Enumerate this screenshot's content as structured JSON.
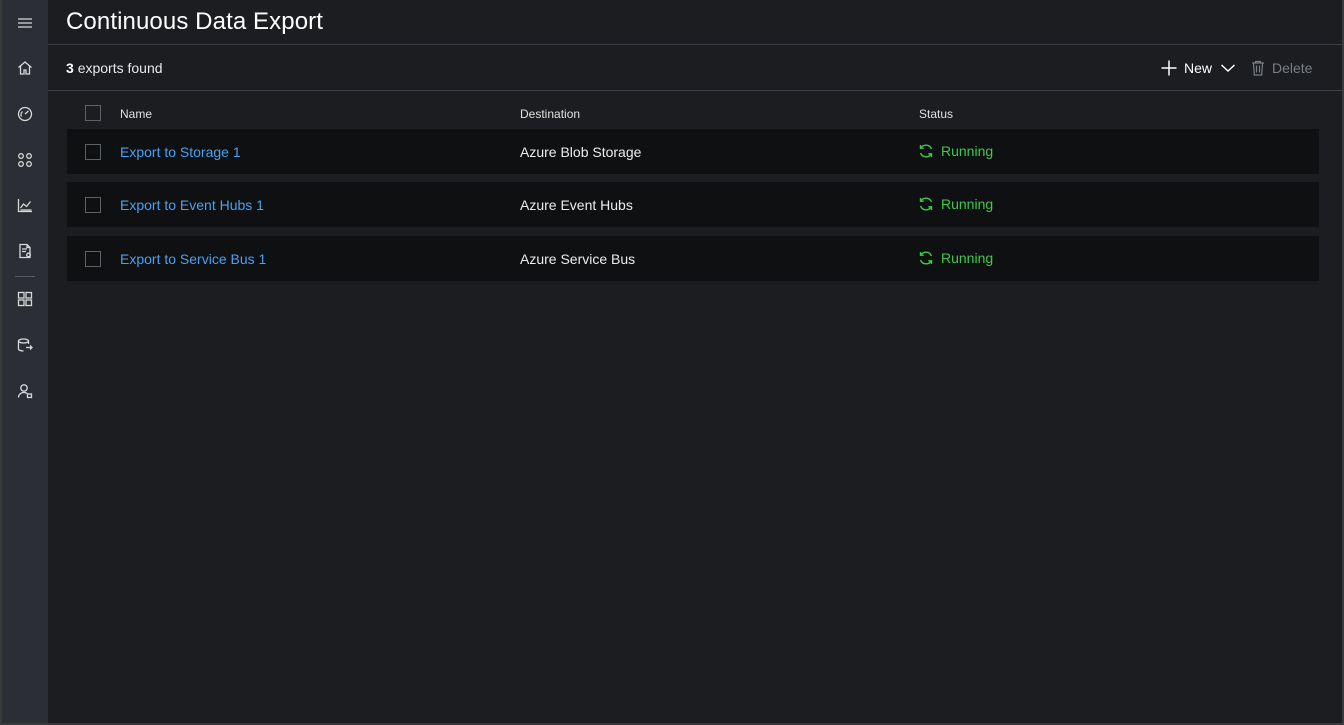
{
  "page": {
    "title": "Continuous Data Export"
  },
  "sidebar": {
    "items": [
      {
        "icon": "hamburger-menu-icon"
      },
      {
        "icon": "home-icon"
      },
      {
        "icon": "dashboard-gauge-icon"
      },
      {
        "icon": "devices-icon"
      },
      {
        "icon": "analytics-chart-icon"
      },
      {
        "icon": "jobs-document-icon"
      },
      {
        "icon": "app-templates-grid-icon"
      },
      {
        "icon": "data-export-icon"
      },
      {
        "icon": "administration-user-icon"
      }
    ]
  },
  "toolbar": {
    "count": "3",
    "count_suffix": "exports found",
    "new_label": "New",
    "delete_label": "Delete"
  },
  "table": {
    "columns": [
      "Name",
      "Destination",
      "Status"
    ],
    "rows": [
      {
        "name": "Export to Storage 1",
        "destination": "Azure Blob Storage",
        "status": "Running"
      },
      {
        "name": "Export to Event Hubs 1",
        "destination": "Azure Event Hubs",
        "status": "Running"
      },
      {
        "name": "Export to Service Bus 1",
        "destination": "Azure Service Bus",
        "status": "Running"
      }
    ]
  },
  "colors": {
    "link": "#4aa0f0",
    "status_running": "#3fc94a",
    "sidebar_bg": "#2b2f35",
    "main_bg": "#1b1d20",
    "row_bg": "#0f1012"
  }
}
